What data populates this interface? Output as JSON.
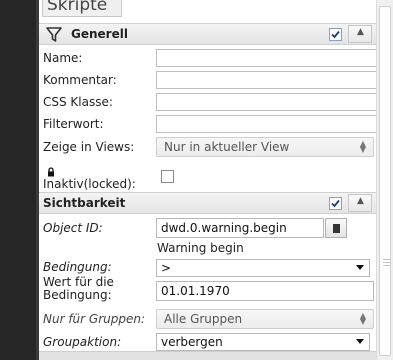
{
  "tab": {
    "label": "Skripte"
  },
  "general": {
    "title": "Generell",
    "enabled": true,
    "collapse_icon": "chevron-up-icon",
    "fields": {
      "name_label": "Name:",
      "comment_label": "Kommentar:",
      "css_class_label": "CSS Klasse:",
      "filter_label": "Filterwort:",
      "views_label": "Zeige in Views:",
      "views_value": "Nur in aktueller View",
      "locked_label": "Inaktiv(locked):",
      "locked_checked": false
    }
  },
  "visibility": {
    "title": "Sichtbarkeit",
    "enabled": true,
    "collapse_icon": "chevron-up-icon",
    "object_id_label": "Object ID:",
    "object_id_value": "dwd.0.warning.begin",
    "object_name": "Warning begin",
    "condition_label": "Bedingung:",
    "condition_value": ">",
    "condition_value_label": "Wert für die Bedingung:",
    "condition_value_value": "01.01.1970",
    "groups_label": "Nur für Gruppen:",
    "groups_value": "Alle Gruppen",
    "group_action_label": "Groupaktion:",
    "group_action_value": "verbergen"
  },
  "colors": {
    "dark_strip": "#262626",
    "header_gradient_top": "#f4f4f4",
    "header_gradient_bottom": "#e4e4e4",
    "checkbox_check": "#1a3a7a"
  }
}
